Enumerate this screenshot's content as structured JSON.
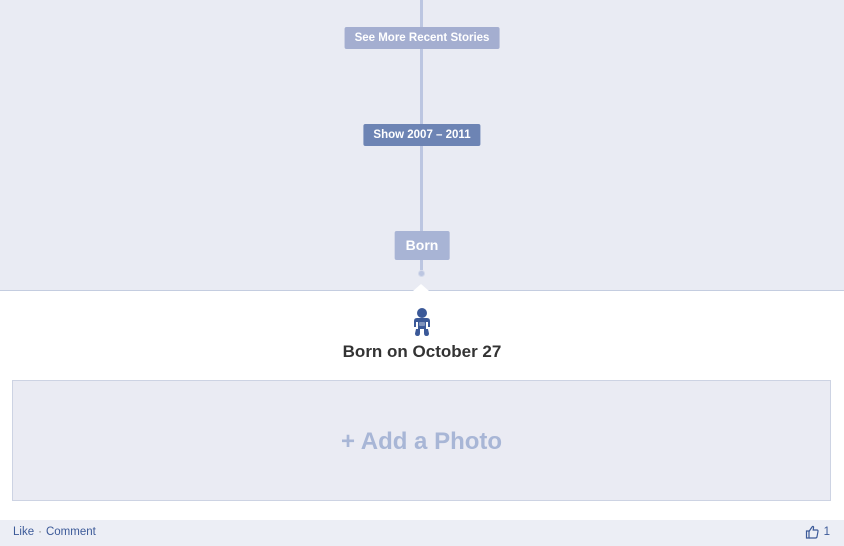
{
  "timeline": {
    "see_more_label": "See More Recent Stories",
    "show_years_label": "Show 2007 – 2011",
    "born_label": "Born"
  },
  "event": {
    "icon": "baby-icon",
    "title": "Born on October 27",
    "add_photo_label": "+ Add a Photo"
  },
  "footer": {
    "like_label": "Like",
    "separator": "·",
    "comment_label": "Comment",
    "like_icon": "thumbs-up-icon",
    "like_count": "1"
  },
  "colors": {
    "timeline_bg": "#e9ebf3",
    "spine": "#bcc6e1",
    "active_button": "#6d84b4",
    "link": "#3b5998",
    "add_photo_text": "#a8b6d6"
  }
}
